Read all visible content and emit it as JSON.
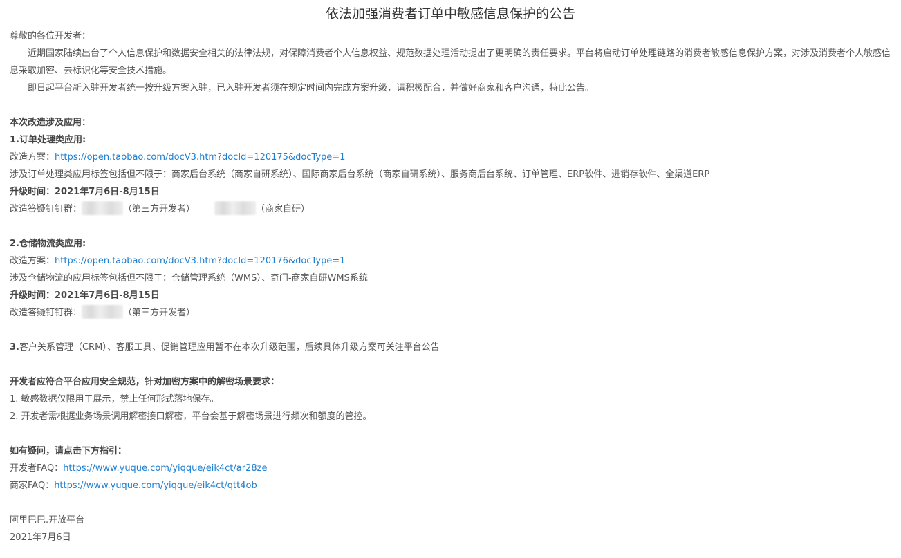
{
  "title": "依法加强消费者订单中敏感信息保护的公告",
  "greeting": "尊敬的各位开发者：",
  "intro_paragraph_1": "近期国家陆续出台了个人信息保护和数据安全相关的法律法规，对保障消费者个人信息权益、规范数据处理活动提出了更明确的责任要求。平台将启动订单处理链路的消费者敏感信息保护方案，对涉及消费者个人敏感信息采取加密、去标识化等安全技术措施。",
  "intro_paragraph_2": "即日起平台新入驻开发者统一按升级方案入驻，已入驻开发者须在规定时间内完成方案升级，请积极配合，并做好商家和客户沟通，特此公告。",
  "scope_heading": "本次改造涉及应用：",
  "section1": {
    "number": "1.",
    "heading": "订单处理类应用:",
    "plan_label": "改造方案：",
    "plan_link": "https://open.taobao.com/docV3.htm?docId=120175&docType=1",
    "tags_text": "涉及订单处理类应用标签包括但不限于：商家后台系统（商家自研系统）、国际商家后台系统（商家自研系统）、服务商后台系统、订单管理、ERP软件、进销存软件、全渠道ERP",
    "time_label": "升级时间：",
    "time_value": "2021年7月6日-8月15日",
    "group_label": "改造答疑钉钉群：",
    "group_1_note": "（第三方开发者）",
    "group_2_note": "（商家自研）"
  },
  "section2": {
    "number": "2.",
    "heading": "仓储物流类应用:",
    "plan_label": "改造方案：",
    "plan_link": "https://open.taobao.com/docV3.htm?docId=120176&docType=1",
    "tags_text": "涉及仓储物流的应用标签包括但不限于：仓储管理系统（WMS）、奇门-商家自研WMS系统",
    "time_label": "升级时间：",
    "time_value": "2021年7月6日-8月15日",
    "group_label": "改造答疑钉钉群：",
    "group_1_note": "（第三方开发者）"
  },
  "section3": {
    "number": "3.",
    "text": "客户关系管理（CRM）、客服工具、促销管理应用暂不在本次升级范围，后续具体升级方案可关注平台公告"
  },
  "requirements": {
    "heading": "开发者应符合平台应用安全规范，针对加密方案中的解密场景要求：",
    "items": [
      "1. 敏感数据仅限用于展示，禁止任何形式落地保存。",
      "2. 开发者需根据业务场景调用解密接口解密，平台会基于解密场景进行频次和额度的管控。"
    ]
  },
  "help": {
    "heading": "如有疑问，请点击下方指引：",
    "developer_faq_label": "开发者FAQ：",
    "developer_faq_link": "https://www.yuque.com/yiqque/eik4ct/ar28ze",
    "merchant_faq_label": "商家FAQ：",
    "merchant_faq_link": "https://www.yuque.com/yiqque/eik4ct/qtt4ob"
  },
  "signature": {
    "org": "阿里巴巴.开放平台",
    "date": "2021年7月6日"
  }
}
